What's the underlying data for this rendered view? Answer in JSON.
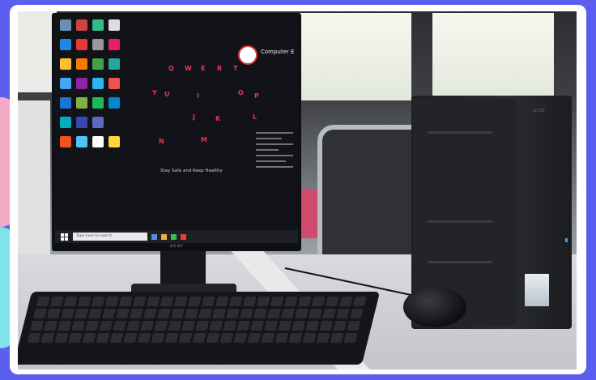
{
  "photo": {
    "subject": "desktop-computer-setup",
    "screen": {
      "logo_text": "Computer E",
      "keyboard_letters": [
        "Q",
        "W",
        "E",
        "R",
        "T",
        "Y",
        "U",
        "I",
        "O",
        "P",
        "J",
        "K",
        "L",
        "N",
        "M"
      ],
      "center_text": "Stay Safe and Keep Healthy",
      "search_placeholder": "Type here to search"
    },
    "monitor_brand": "acer"
  },
  "colors": {
    "background": "#5b5ff0",
    "frame": "#ffffff",
    "accent_pink": "#f4a9c7",
    "accent_cyan": "#7fe3e9",
    "screen_accent": "#e8364d"
  }
}
